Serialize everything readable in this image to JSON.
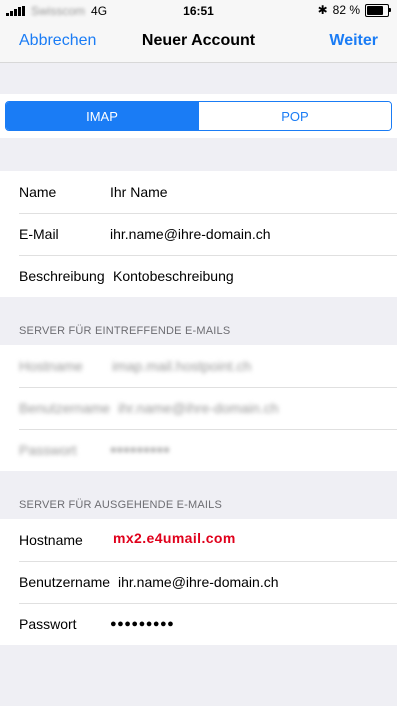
{
  "status_bar": {
    "carrier": "Swisscom",
    "network": "4G",
    "time": "16:51",
    "bluetooth": "✱",
    "battery_text": "82 %",
    "battery_level": 0.82
  },
  "nav": {
    "cancel_label": "Abbrechen",
    "title": "Neuer Account",
    "next_label": "Weiter"
  },
  "segment": {
    "options": [
      "IMAP",
      "POP"
    ],
    "selected": "IMAP"
  },
  "account": {
    "rows": [
      {
        "label": "Name",
        "value": "Ihr Name"
      },
      {
        "label": "E-Mail",
        "value": "ihr.name@ihre-domain.ch"
      },
      {
        "label": "Beschreibung",
        "value": "Kontobeschreibung"
      }
    ]
  },
  "incoming": {
    "header": "SERVER FÜR EINTREFFENDE E-MAILS",
    "rows": [
      {
        "label": "Hostname",
        "value": "imap.mail.hostpoint.ch"
      },
      {
        "label": "Benutzername",
        "value": "ihr.name@ihre-domain.ch"
      },
      {
        "label": "Passwort",
        "value": "●●●●●●●●●"
      }
    ]
  },
  "outgoing": {
    "header": "SERVER FÜR AUSGEHENDE E-MAILS",
    "rows": [
      {
        "label": "Hostname",
        "value": "mx2.e4umail.com"
      },
      {
        "label": "Benutzername",
        "value": "ihr.name@ihre-domain.ch"
      },
      {
        "label": "Passwort",
        "value": "●●●●●●●●●"
      }
    ]
  },
  "colors": {
    "accent": "#1a7cf5",
    "hostname_highlight": "#e0001b",
    "background": "#efeff4"
  }
}
